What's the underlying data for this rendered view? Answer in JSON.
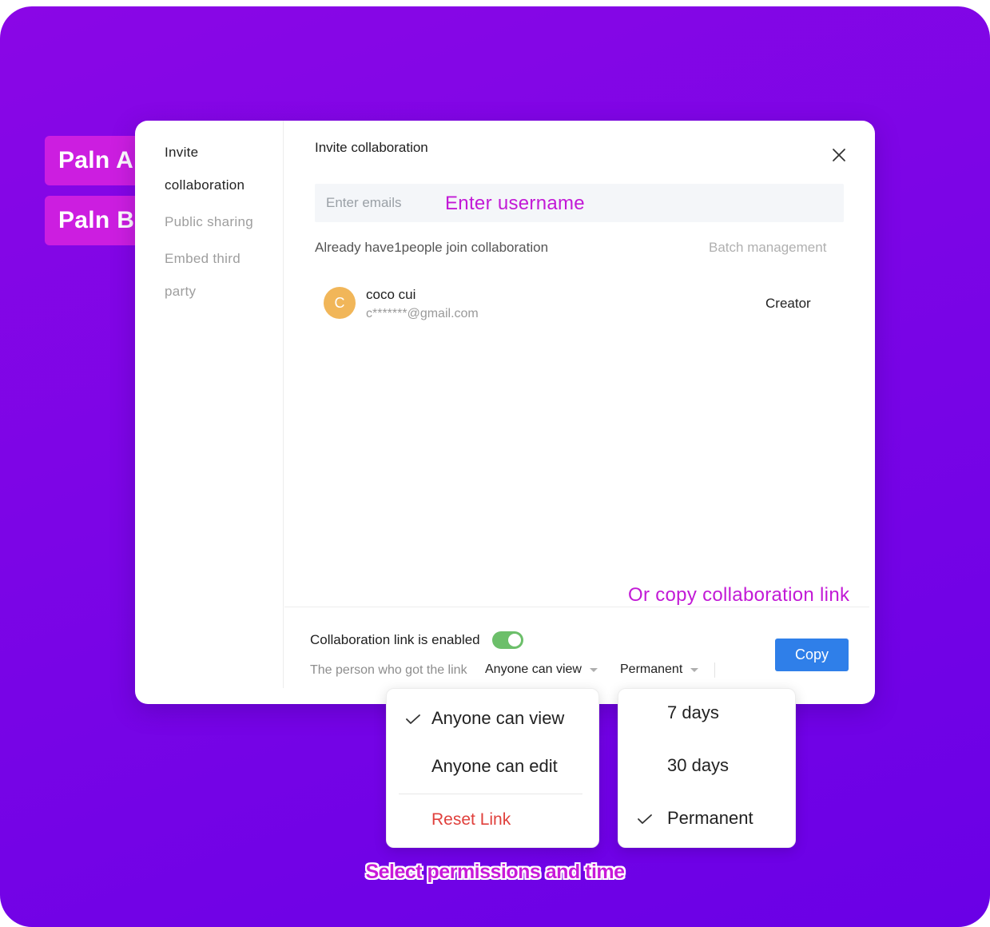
{
  "plans": {
    "plan_a": "Paln A",
    "plan_b": "Paln B"
  },
  "sidebar": {
    "items": [
      {
        "label": "Invite collaboration",
        "active": true
      },
      {
        "label": "Public sharing",
        "active": false
      },
      {
        "label": "Embed third party",
        "active": false
      }
    ]
  },
  "dialog": {
    "title": "Invite collaboration",
    "email_placeholder": "Enter emails",
    "username_hint": "Enter username",
    "join_count_text": "Already have1people join collaboration",
    "batch_management": "Batch management",
    "user": {
      "avatar_letter": "C",
      "name": "coco cui",
      "email": "c*******@gmail.com",
      "role": "Creator"
    },
    "copy_link_hint": "Or copy collaboration link",
    "link_enabled_label": "Collaboration link is enabled",
    "link_enabled": true,
    "link_description": "The person who got the link",
    "permission_selected": "Anyone can view",
    "time_selected": "Permanent",
    "copy_button": "Copy"
  },
  "permission_menu": {
    "options": [
      "Anyone can view",
      "Anyone can edit"
    ],
    "selected": "Anyone can view",
    "reset_link": "Reset Link"
  },
  "time_menu": {
    "options": [
      "7 days",
      "30 days",
      "Permanent"
    ],
    "selected": "Permanent"
  },
  "caption": "Select permissions and time",
  "colors": {
    "background": "#7b05e6",
    "plan_tag": "#cc1ee0",
    "highlight_text": "#c21ad6",
    "copy_button": "#2f7fe9",
    "toggle_on": "#6cbf6a",
    "reset_link": "#e0403c",
    "avatar": "#f1b659"
  }
}
